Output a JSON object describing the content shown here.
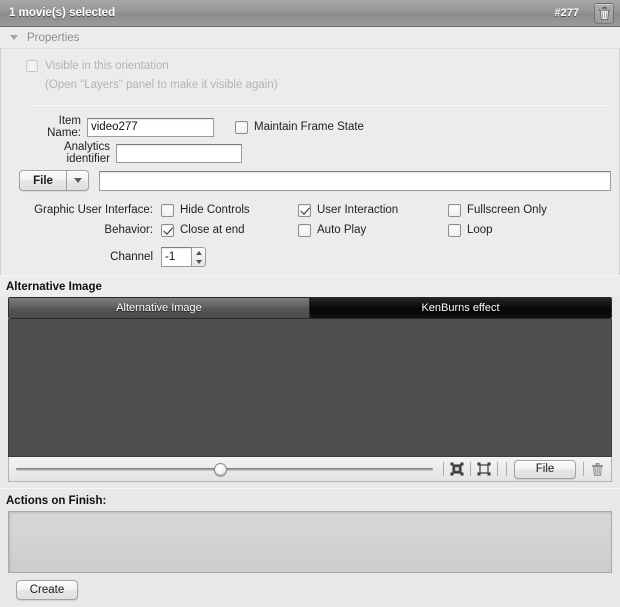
{
  "titlebar": {
    "title": "1 movie(s) selected",
    "id_badge": "#277",
    "trash_icon": "trash-icon"
  },
  "properties": {
    "header_label": "Properties",
    "disclosure_icon": "triangle-down-icon",
    "visible_checkbox": {
      "label": "Visible in this orientation",
      "checked": false,
      "enabled": false
    },
    "visible_hint": "(Open \"Layers\" panel to make it visible again)",
    "item_name": {
      "label": "Item Name:",
      "value": "video277",
      "placeholder": ""
    },
    "maintain_frame_state": {
      "label": "Maintain Frame State",
      "checked": false
    },
    "analytics": {
      "label": "Analytics identifier",
      "value": "",
      "placeholder": ""
    },
    "file_button": {
      "label": "File",
      "dropdown_icon": "chevron-down-icon"
    },
    "file_path": {
      "value": "",
      "placeholder": ""
    },
    "gui": {
      "label": "Graphic User Interface:",
      "options": [
        {
          "label": "Hide Controls",
          "checked": false
        },
        {
          "label": "User Interaction",
          "checked": true
        },
        {
          "label": "Fullscreen Only",
          "checked": false
        }
      ]
    },
    "behavior": {
      "label": "Behavior:",
      "options": [
        {
          "label": "Close at end",
          "checked": true
        },
        {
          "label": "Auto Play",
          "checked": false
        },
        {
          "label": "Loop",
          "checked": false
        }
      ]
    },
    "channel": {
      "label": "Channel",
      "value": "-1",
      "stepper_up_icon": "triangle-up-icon",
      "stepper_down_icon": "triangle-down-icon"
    }
  },
  "alternative_image": {
    "section_title": "Alternative Image",
    "tabs": [
      {
        "label": "Alternative Image",
        "active": true
      },
      {
        "label": "KenBurns effect",
        "active": false
      }
    ],
    "preview_color": "#4f4f4f",
    "toolbar": {
      "slider_percent": 49,
      "icons": [
        "fit-image-filled-icon",
        "fit-image-outline-icon"
      ],
      "file_label": "File",
      "trash_icon": "trash-icon"
    }
  },
  "actions_on_finish": {
    "title": "Actions on Finish:",
    "items": [],
    "create_label": "Create"
  },
  "colors": {
    "panel_bg": "#ececec",
    "titlebar": "#949494",
    "preview": "#4f4f4f",
    "tab_active": "#606060",
    "tab_inactive": "#0c0c0c"
  }
}
